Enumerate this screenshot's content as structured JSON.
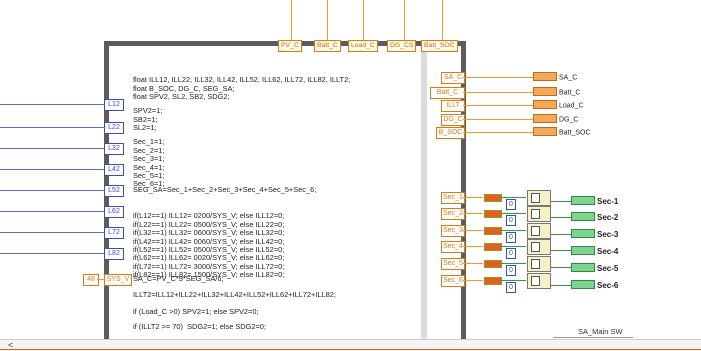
{
  "top_outputs": [
    "PV_C",
    "Batt_C",
    "Load_C",
    "DG_CS",
    "Batt_SOC"
  ],
  "left_inputs": [
    "L12",
    "L22",
    "L32",
    "L42",
    "L52",
    "L62",
    "L72",
    "L82"
  ],
  "sys_v": {
    "const": "48",
    "label": "SYS_V"
  },
  "code": {
    "decl": [
      "float ILL12, ILL22, ILL32, ILL42, ILL52, ILL62, ILL72, ILL82, ILLT2;",
      "float B_SOC, DG_C, SEG_SA;",
      "float SPV2, SL2, SB2, SDG2;"
    ],
    "init": [
      "SPV2=1;",
      "SB2=1;",
      "SL2=1;"
    ],
    "secs": [
      "Sec_1=1;",
      "Sec_2=1;",
      "Sec_3=1;",
      "Sec_4=1;",
      "Sec_5=1;",
      "Sec_6=1;"
    ],
    "seg": "SEG_SA=Sec_1+Sec_2+Sec_3+Sec_4+Sec_5+Sec_6;",
    "ifs": [
      "if(L12==1) ILL12= 0200/SYS_V; else ILL12=0;",
      "if(L22==1) ILL22= 0500/SYS_V; else ILL22=0;",
      "if(L32==1) ILL32= 0600/SYS_V; else ILL32=0;",
      "if(L42==1) ILL42= 0060/SYS_V; else ILL42=0;",
      "if(L52==1) ILL52= 0500/SYS_V; else ILL52=0;",
      "if(L62==1) ILL62= 0020/SYS_V; else ILL62=0;",
      "if(L72==1) ILL72= 3000/SYS_V; else ILL72=0;",
      "if(L82==1) ILL82= 1500/SYS_V; else ILL82=0;"
    ],
    "sac": "SA_C=PV_C*9*SEG_SA/6;",
    "illt": "ILLT2=ILL12+ILL22+ILL32+ILL42+ILL52+ILL62+ILL72+ILL82;",
    "load": "if (Load_C >0) SPV2=1; else SPV2=0;",
    "sdg": "if (ILLT2 >= 70)  SDG2=1; else SDG2=0;"
  },
  "right_outputs": [
    {
      "node": "SA_C",
      "label": "SA_C"
    },
    {
      "node": "Batt_C",
      "label": "Batt_C"
    },
    {
      "node": "ILLT",
      "label": "Load_C"
    },
    {
      "node": "DG_C",
      "label": "DG_C"
    },
    {
      "node": "B_SOC",
      "label": "Batt_SOC"
    }
  ],
  "sec_nodes": [
    "Sec_1",
    "Sec_2",
    "Sec_3",
    "Sec_4",
    "Sec_5",
    "Sec_6"
  ],
  "sec_labels": [
    "Sec-1",
    "Sec-2",
    "Sec-3",
    "Sec-4",
    "Sec-5",
    "Sec-6"
  ],
  "zero": "0",
  "footer": {
    "label": "SA_Main SW",
    "scroll_left": "<"
  },
  "colors": {
    "orange": "#f39a2a",
    "blue": "#5a6bd6",
    "green": "#2f9a4a",
    "frame": "#5c5c5c"
  }
}
